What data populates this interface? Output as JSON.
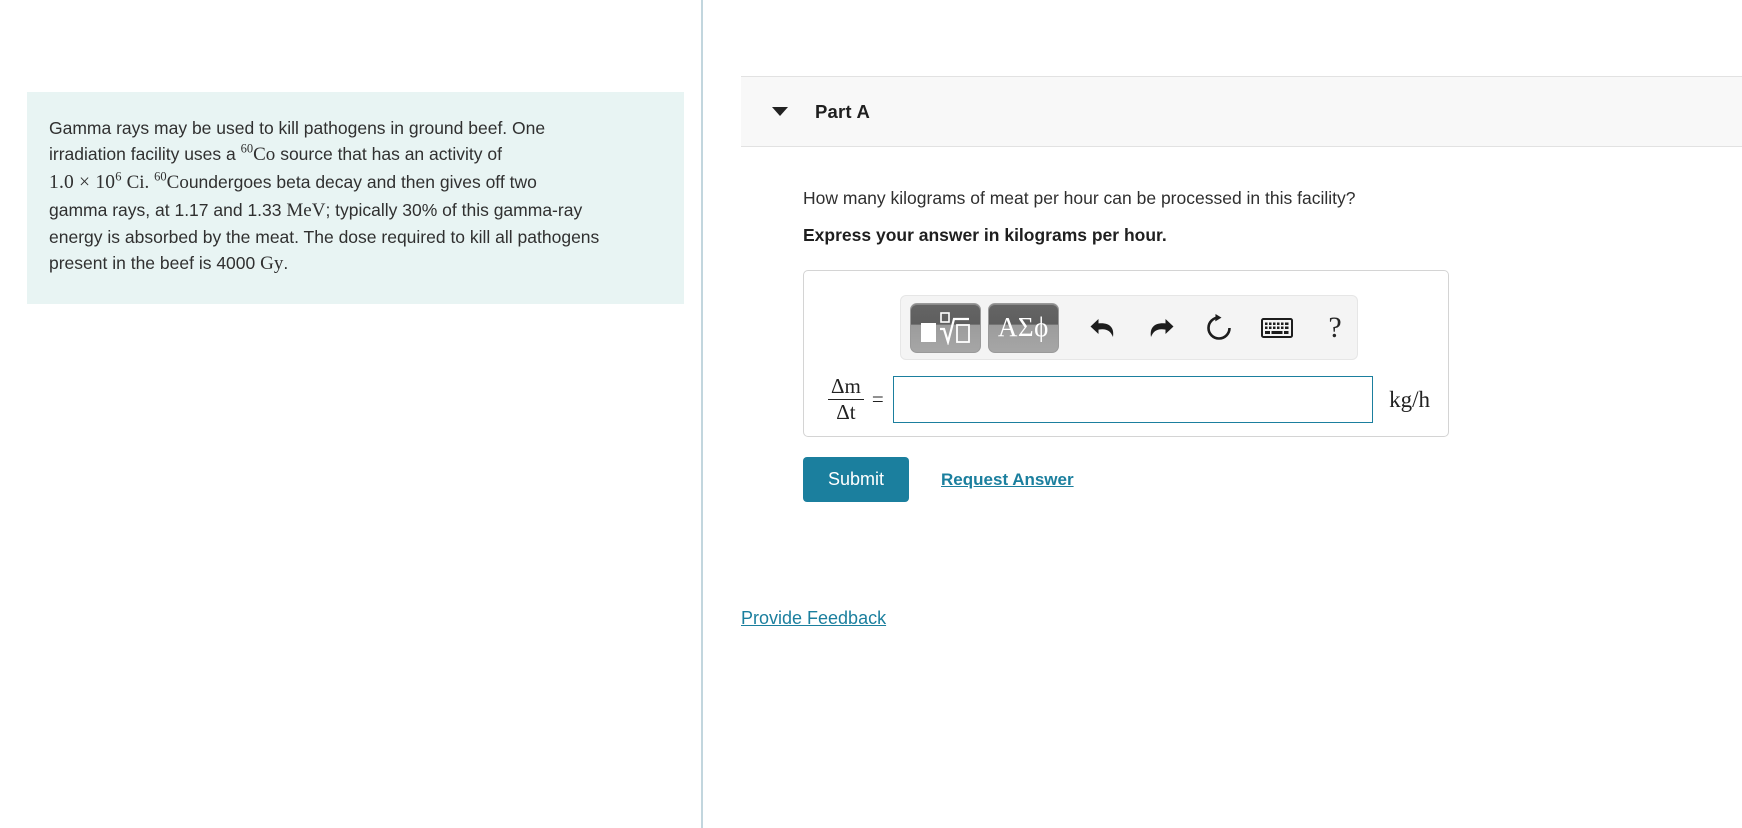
{
  "problem": {
    "line1": "Gamma rays may be used to kill pathogens in ground beef. One",
    "line2_a": "irradiation facility uses a",
    "isotope_sup": "60",
    "isotope_sym": "Co",
    "line2_b": "source that has an activity of",
    "value_mantissa": "1.0 × 10",
    "value_exponent": "6",
    "value_unit": "Ci.",
    "line3_b": "undergoes beta decay and then gives off two",
    "line4_a": "gamma rays, at 1.17 and 1.33",
    "energy_unit": "MeV",
    "line4_b": "; typically 30% of this gamma-ray",
    "line5": "energy is absorbed by the meat. The dose required to kill all pathogens",
    "line6_a": "present in the beef is 4000",
    "dose_unit": "Gy",
    "line6_b": "."
  },
  "part": {
    "title": "Part A",
    "caret": "chevron-down",
    "question": "How many kilograms of meat per hour can be processed in this facility?",
    "instruction": "Express your answer in kilograms per hour."
  },
  "mathbar": {
    "template_button": "template-math-icon",
    "greek_button": "ΑΣϕ",
    "undo": "undo-icon",
    "redo": "redo-icon",
    "reset": "reset-icon",
    "keyboard": "keyboard-icon",
    "help": "?"
  },
  "answer": {
    "numerator": "Δm",
    "denominator": "Δt",
    "equals": "=",
    "value": "",
    "placeholder": "",
    "unit": "kg/h"
  },
  "actions": {
    "submit_label": "Submit",
    "request_label": "Request Answer",
    "feedback_label": "Provide Feedback"
  },
  "colors": {
    "accent": "#1b7f9e",
    "problem_bg": "#e8f4f3",
    "header_bg": "#f8f8f8",
    "divider": "#c2d6de"
  }
}
